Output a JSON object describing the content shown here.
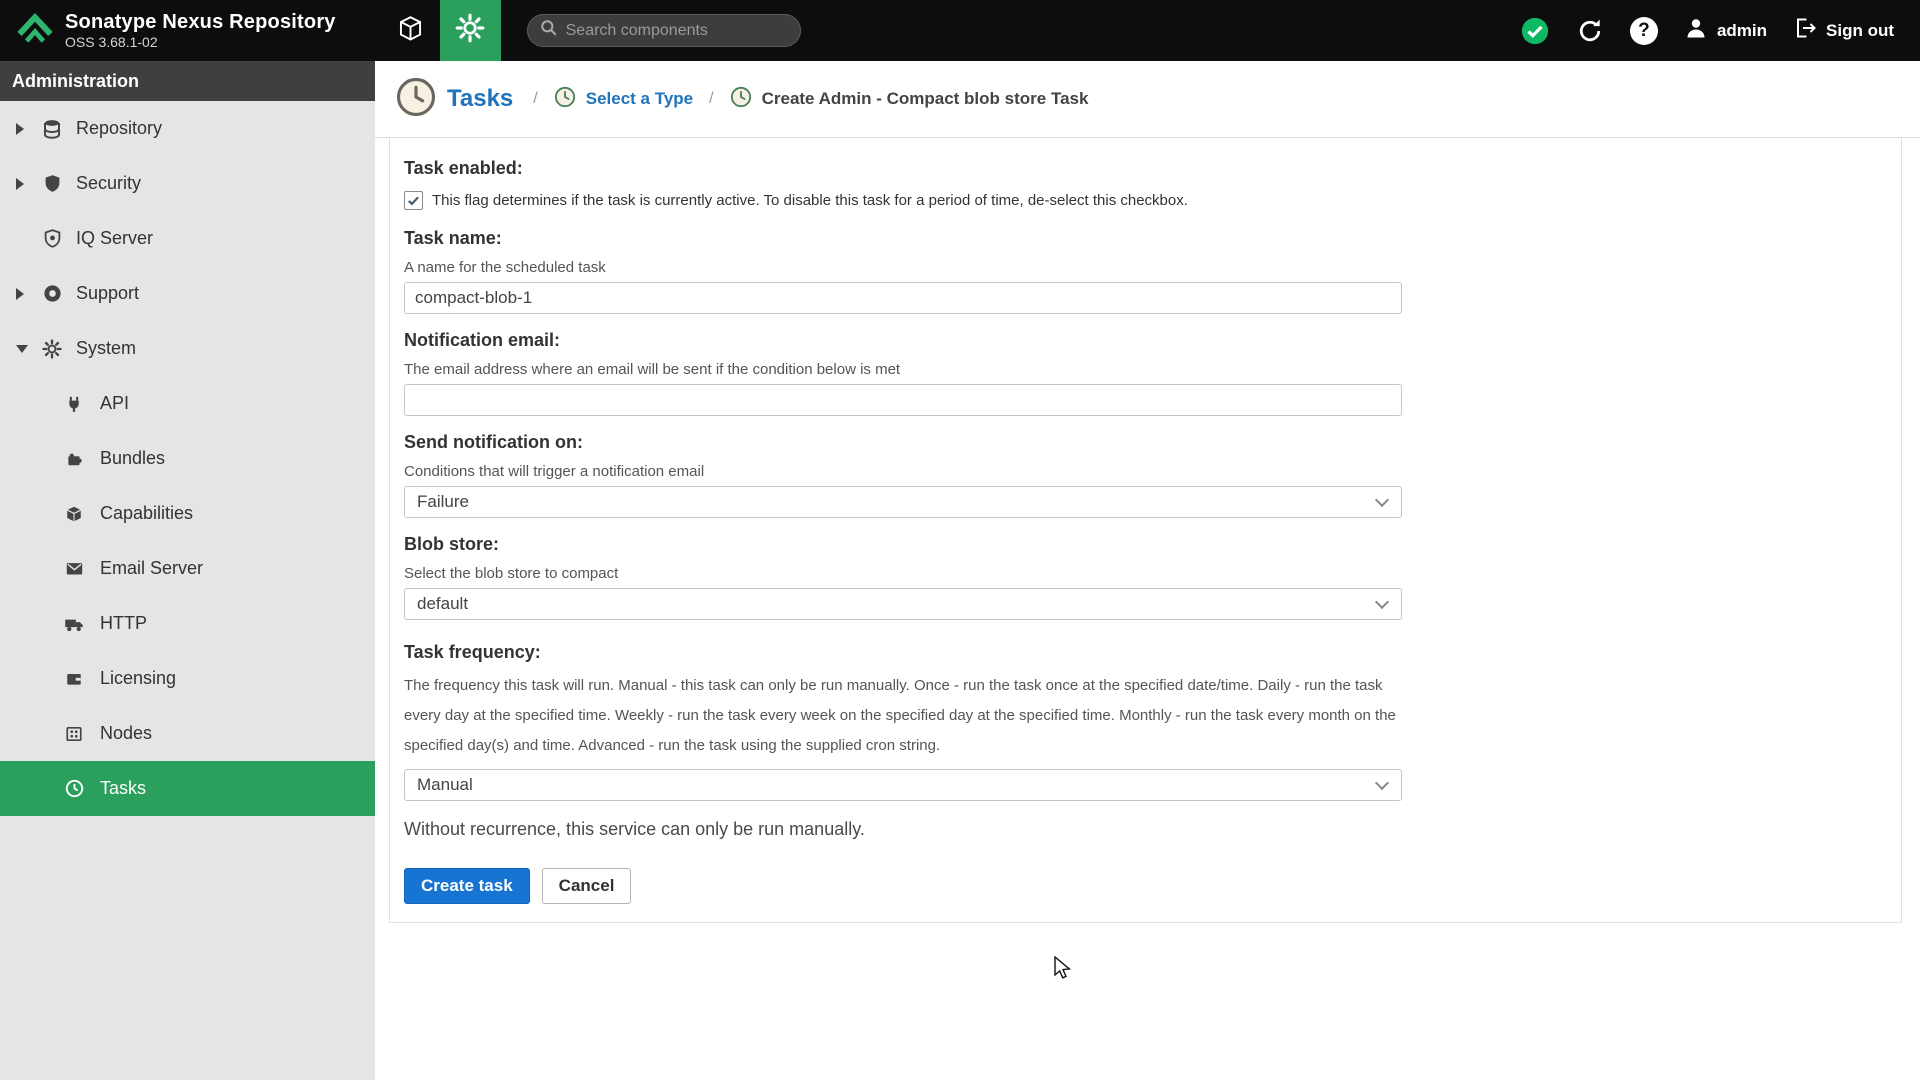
{
  "colors": {
    "accent_green": "#2aa05c",
    "status_green": "#0fb863",
    "link_blue": "#2173bb",
    "button_blue": "#1874d2",
    "header_bg": "#0d0d0d",
    "sidebar_bg": "#e5e5e5",
    "admin_bar_bg": "#3f3f3f"
  },
  "header": {
    "app_title": "Sonatype Nexus Repository",
    "app_version": "OSS 3.68.1-02",
    "search_placeholder": "Search components",
    "help_glyph": "?",
    "user_label": "admin",
    "sign_out_label": "Sign out"
  },
  "sidebar": {
    "title": "Administration",
    "items": [
      {
        "label": "Repository",
        "icon": "database-icon"
      },
      {
        "label": "Security",
        "icon": "shield-icon"
      },
      {
        "label": "IQ Server",
        "icon": "iq-shield-icon"
      },
      {
        "label": "Support",
        "icon": "life-ring-icon"
      },
      {
        "label": "System",
        "icon": "gear-icon"
      }
    ],
    "system_items": [
      {
        "label": "API",
        "icon": "plug-icon"
      },
      {
        "label": "Bundles",
        "icon": "puzzle-icon"
      },
      {
        "label": "Capabilities",
        "icon": "cube-icon"
      },
      {
        "label": "Email Server",
        "icon": "envelope-icon"
      },
      {
        "label": "HTTP",
        "icon": "truck-icon"
      },
      {
        "label": "Licensing",
        "icon": "wallet-icon"
      },
      {
        "label": "Nodes",
        "icon": "nodes-icon"
      },
      {
        "label": "Tasks",
        "icon": "clock-icon"
      }
    ]
  },
  "breadcrumb": {
    "root": "Tasks",
    "separator": "/",
    "middle": "Select a Type",
    "current": "Create Admin - Compact blob store Task"
  },
  "form": {
    "task_enabled": {
      "label": "Task enabled:",
      "checked": true,
      "help": "This flag determines if the task is currently active. To disable this task for a period of time, de-select this checkbox."
    },
    "task_name": {
      "label": "Task name:",
      "help": "A name for the scheduled task",
      "value": "compact-blob-1"
    },
    "notification_email": {
      "label": "Notification email:",
      "help": "The email address where an email will be sent if the condition below is met",
      "value": ""
    },
    "send_notification_on": {
      "label": "Send notification on:",
      "help": "Conditions that will trigger a notification email",
      "value": "Failure"
    },
    "blob_store": {
      "label": "Blob store:",
      "help": "Select the blob store to compact",
      "value": "default"
    },
    "task_frequency": {
      "label": "Task frequency:",
      "help": "The frequency this task will run. Manual - this task can only be run manually. Once - run the task once at the specified date/time. Daily - run the task every day at the specified time. Weekly - run the task every week on the specified day at the specified time. Monthly - run the task every month on the specified day(s) and time. Advanced - run the task using the supplied cron string.",
      "value": "Manual"
    },
    "recurrence_note": "Without recurrence, this service can only be run manually.",
    "buttons": {
      "create": "Create task",
      "cancel": "Cancel"
    }
  }
}
